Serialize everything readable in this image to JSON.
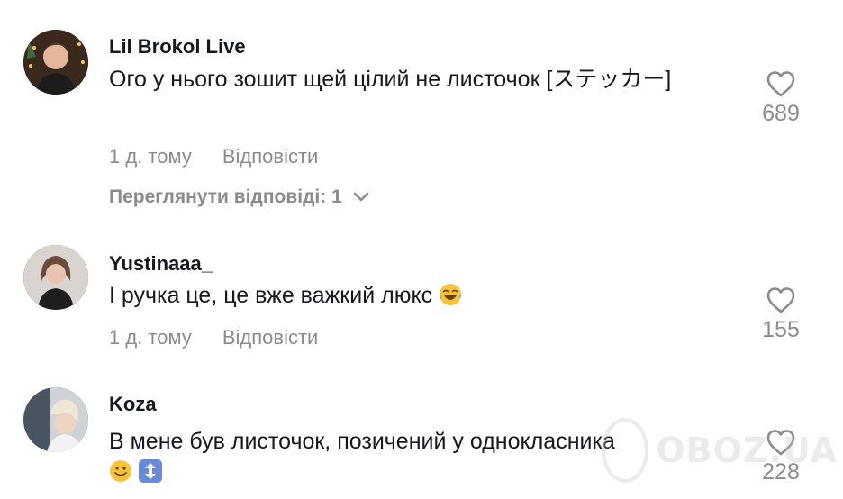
{
  "comments": [
    {
      "username": "Lil Brokol Live",
      "text": "Ого у нього зошит щей цілий не листочок [ステッカー]",
      "time": "1 д. тому",
      "reply_label": "Відповісти",
      "likes": "689",
      "view_replies": "Переглянути відповіді: 1"
    },
    {
      "username": "Yustinaaa_",
      "text": "І ручка це, це вже важкий люкс",
      "time": "1 д. тому",
      "reply_label": "Відповісти",
      "likes": "155"
    },
    {
      "username": "Koza",
      "text": "В мене був листочок, позичений у однокласника",
      "likes": "228"
    }
  ],
  "watermark": {
    "text": "OBOZ.UA"
  },
  "icons": {
    "like": "heart-outline-icon",
    "expand": "chevron-down-icon",
    "emoji_laugh": "tears-of-joy-emoji-icon",
    "emoji_smile": "slightly-smiling-emoji-icon",
    "emoji_arrow": "up-down-arrow-emoji-icon"
  },
  "colors": {
    "text": "#161823",
    "muted": "#8a8b91"
  }
}
